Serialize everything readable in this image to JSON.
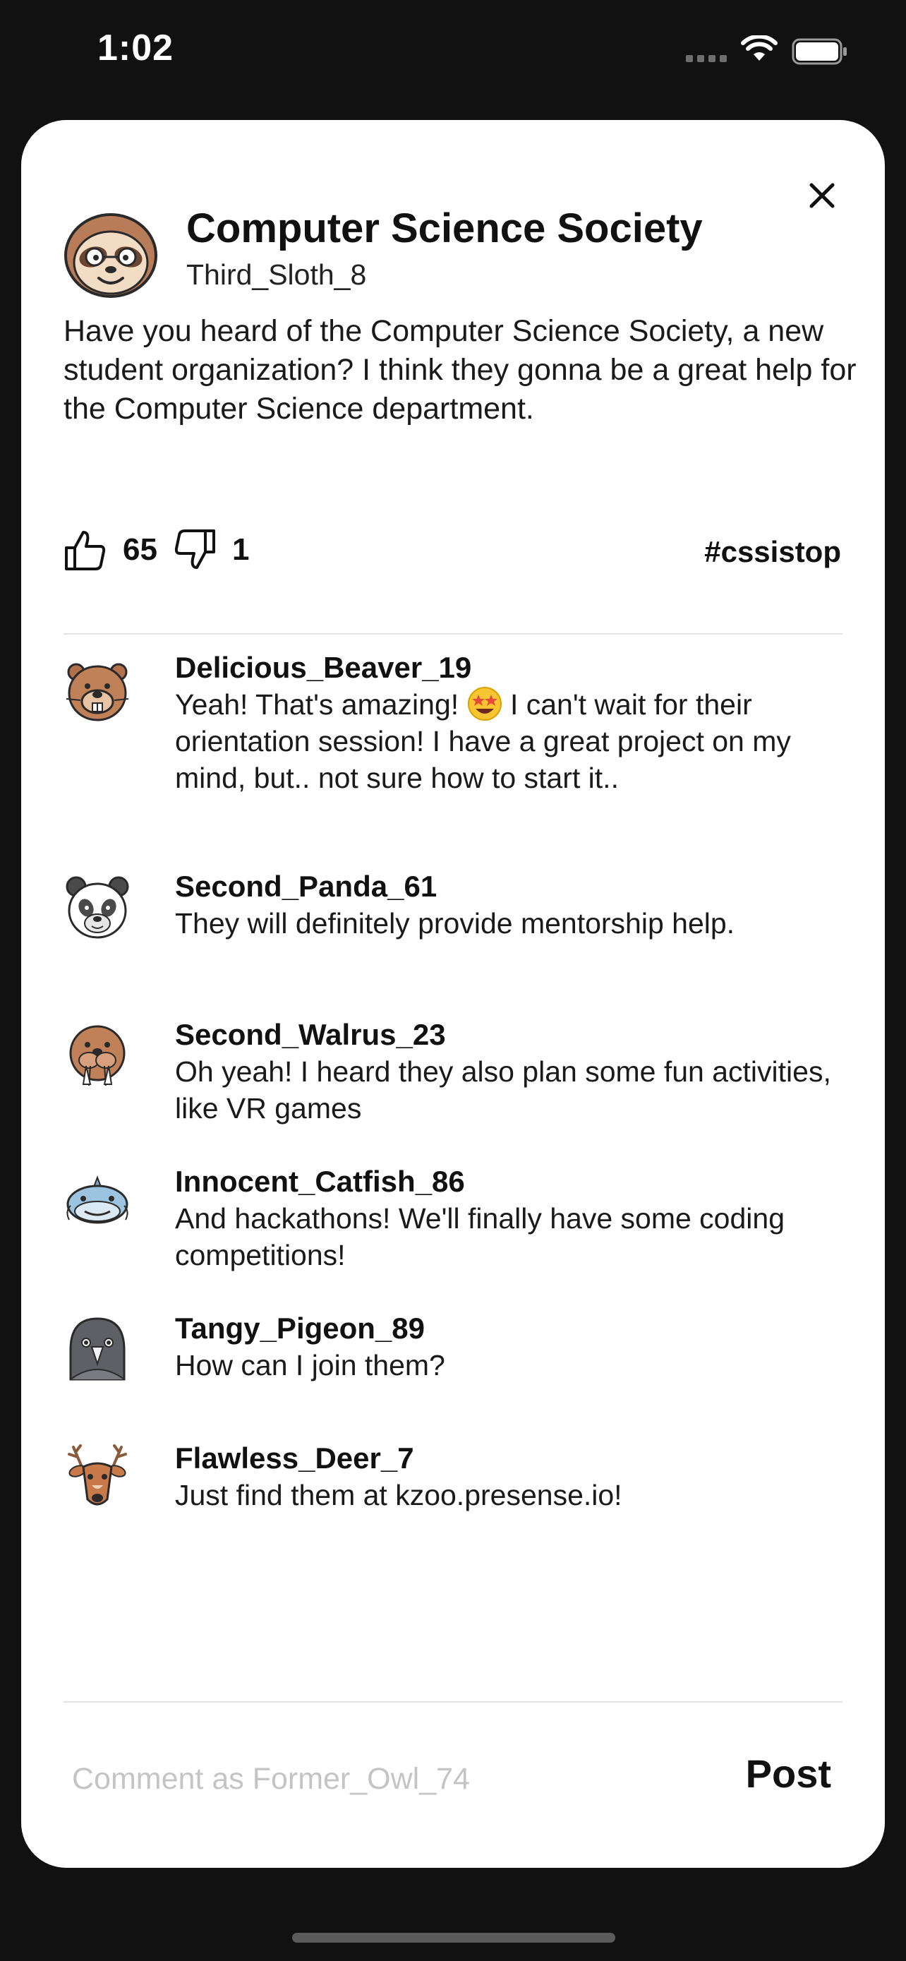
{
  "status_bar": {
    "time": "1:02"
  },
  "post": {
    "title": "Computer Science Society",
    "author": "Third_Sloth_8",
    "author_avatar": "sloth-icon",
    "body": "Have you heard of the Computer Science Society, a new student organization? I think they gonna be a great help for the Computer Science department.",
    "likes": "65",
    "dislikes": "1",
    "hashtag": "#cssistop"
  },
  "comments": [
    {
      "user": "Delicious_Beaver_19",
      "avatar": "beaver-icon",
      "text_before_emoji": "Yeah! That's amazing! ",
      "emoji": "star-struck-emoji",
      "text_after_emoji": " I can't wait for their orientation session! I have a great project on my mind, but.. not sure how to start it.."
    },
    {
      "user": "Second_Panda_61",
      "avatar": "panda-icon",
      "text": "They will definitely provide mentorship help."
    },
    {
      "user": "Second_Walrus_23",
      "avatar": "walrus-icon",
      "text": "Oh yeah! I heard they also plan some fun activities, like VR games"
    },
    {
      "user": "Innocent_Catfish_86",
      "avatar": "catfish-icon",
      "text": "And hackathons! We'll finally have some coding competitions!"
    },
    {
      "user": "Tangy_Pigeon_89",
      "avatar": "pigeon-icon",
      "text": "How can I join them?"
    },
    {
      "user": "Flawless_Deer_7",
      "avatar": "deer-icon",
      "text": "Just find them at kzoo.presense.io!"
    }
  ],
  "composer": {
    "placeholder": "Comment as Former_Owl_74",
    "post_label": "Post"
  }
}
